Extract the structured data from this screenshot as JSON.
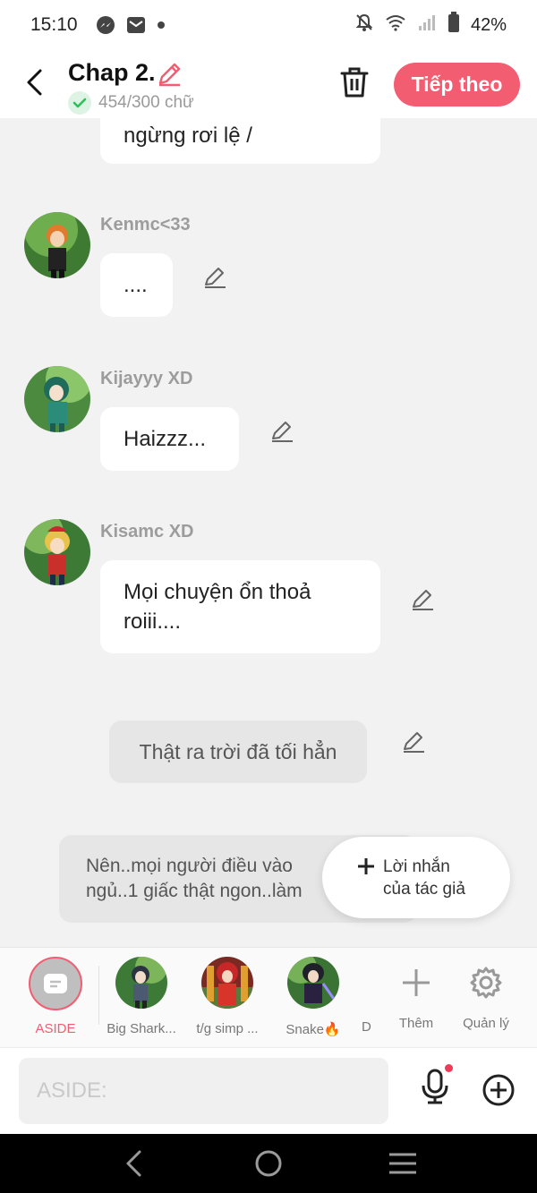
{
  "status_bar": {
    "time": "15:10",
    "battery": "42%"
  },
  "header": {
    "title": "Chap 2.",
    "word_count": "454/300 chữ",
    "next_label": "Tiếp theo",
    "accent": "#f25d72"
  },
  "messages": [
    {
      "text": "ngừng rơi lệ /"
    },
    {
      "name": "Kenmc<33",
      "text": "...."
    },
    {
      "name": "Kijayyy XD",
      "text": "Haizzz..."
    },
    {
      "name": "Kisamc XD",
      "text_line1": "Mọi chuyện ổn thoả",
      "text_line2": "roiii...."
    }
  ],
  "narrations": [
    {
      "text": "Thật ra trời đã tối hẳn"
    },
    {
      "text_line1": "Nên..mọi người điều vào",
      "text_line2": "ngủ..1 giấc thật ngon..làm"
    }
  ],
  "author_note": {
    "line1": "Lời nhắn",
    "line2": "của tác giả"
  },
  "characters": [
    {
      "label": "ASIDE"
    },
    {
      "label": "Big Shark..."
    },
    {
      "label": "t/g simp ..."
    },
    {
      "label": "Snake🔥"
    },
    {
      "label": "D"
    }
  ],
  "tray_actions": {
    "add_label": "Thêm",
    "manage_label": "Quản lý"
  },
  "input": {
    "placeholder": "ASIDE:"
  }
}
